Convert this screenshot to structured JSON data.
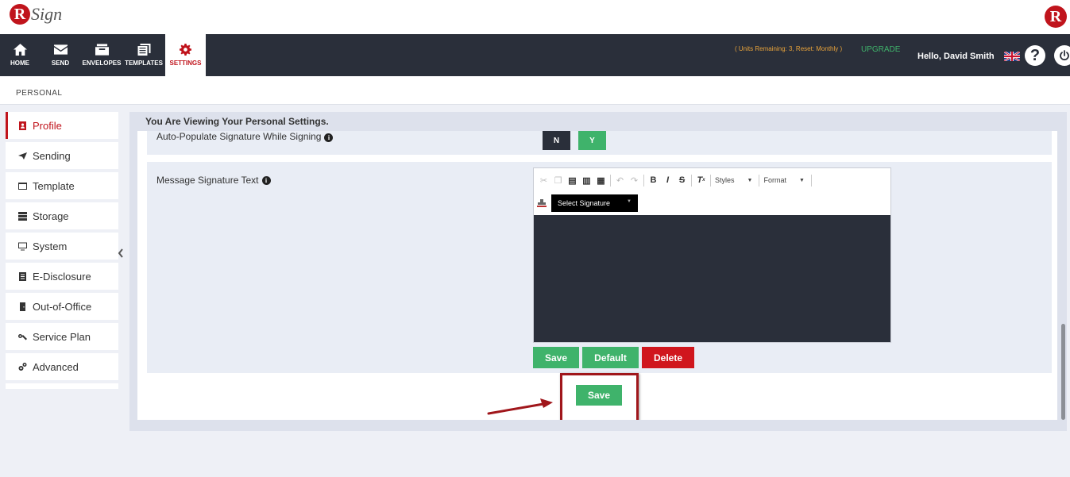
{
  "brand": {
    "logo_letter": "R",
    "logo_word": "Sign",
    "right_logo_letter": "R"
  },
  "nav": {
    "items": [
      {
        "label": "HOME",
        "icon": "home-icon"
      },
      {
        "label": "SEND",
        "icon": "mail-icon"
      },
      {
        "label": "ENVELOPES",
        "icon": "envelopes-icon"
      },
      {
        "label": "TEMPLATES",
        "icon": "templates-icon"
      },
      {
        "label": "SETTINGS",
        "icon": "gear-icon",
        "active": true
      }
    ],
    "units_text": "( Units Remaining: 3, Reset: Monthly )",
    "upgrade_label": "UPGRADE",
    "hello_prefix": "Hello,",
    "user_name": "David Smith",
    "help_glyph": "?",
    "flag_icon": "uk-flag-icon",
    "power_icon": "power-icon"
  },
  "subheader": {
    "label": "PERSONAL"
  },
  "sidebar": {
    "items": [
      {
        "label": "Profile",
        "icon": "profile-icon",
        "active": true
      },
      {
        "label": "Sending",
        "icon": "paper-plane-icon"
      },
      {
        "label": "Template",
        "icon": "window-icon"
      },
      {
        "label": "Storage",
        "icon": "database-icon"
      },
      {
        "label": "System",
        "icon": "monitor-icon"
      },
      {
        "label": "E-Disclosure",
        "icon": "document-icon"
      },
      {
        "label": "Out-of-Office",
        "icon": "door-icon"
      },
      {
        "label": "Service Plan",
        "icon": "keys-icon"
      },
      {
        "label": "Advanced",
        "icon": "cogs-icon"
      }
    ]
  },
  "main": {
    "heading": "You Are Viewing Your Personal Settings.",
    "auto_populate": {
      "label": "Auto-Populate Signature While Signing",
      "no_label": "N",
      "yes_label": "Y"
    },
    "message_signature": {
      "label": "Message Signature Text",
      "styles_label": "Styles",
      "format_label": "Format",
      "select_signature_label": "Select Signature",
      "save_label": "Save",
      "default_label": "Default",
      "delete_label": "Delete"
    },
    "save_label": "Save"
  },
  "colors": {
    "brand_red": "#c0141c",
    "nav_dark": "#2a2f3a",
    "green": "#3fb36b",
    "delete_red": "#d0161d",
    "units_orange": "#e8a33a"
  }
}
